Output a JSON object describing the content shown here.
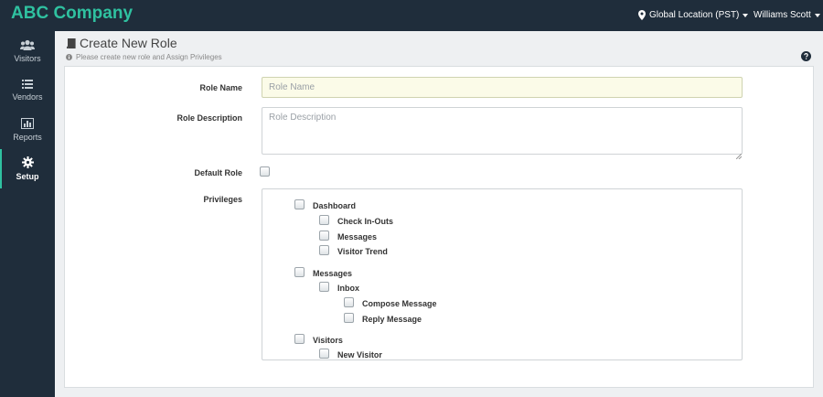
{
  "topbar": {
    "brand": "ABC Company",
    "location": "Global Location (PST)",
    "user": "Williams Scott"
  },
  "sidebar": {
    "items": [
      {
        "label": "Visitors",
        "icon": "users-icon"
      },
      {
        "label": "Vendors",
        "icon": "list-icon"
      },
      {
        "label": "Reports",
        "icon": "bar-chart-icon"
      },
      {
        "label": "Setup",
        "icon": "gear-icon",
        "active": true
      }
    ]
  },
  "page": {
    "title": "Create New Role",
    "subtitle": "Please create new role and Assign Privileges"
  },
  "form": {
    "role_name_label": "Role Name",
    "role_name_placeholder": "Role Name",
    "role_name_value": "",
    "role_desc_label": "Role Description",
    "role_desc_placeholder": "Role Description",
    "role_desc_value": "",
    "default_role_label": "Default Role",
    "default_role_checked": false,
    "privileges_label": "Privileges"
  },
  "privileges": [
    {
      "label": "Dashboard",
      "level": 0,
      "checked": false
    },
    {
      "label": "Check In-Outs",
      "level": 1,
      "checked": false
    },
    {
      "label": "Messages",
      "level": 1,
      "checked": false
    },
    {
      "label": "Visitor Trend",
      "level": 1,
      "checked": false
    },
    {
      "label": "Messages",
      "level": 0,
      "checked": false
    },
    {
      "label": "Inbox",
      "level": 1,
      "checked": false
    },
    {
      "label": "Compose Message",
      "level": 2,
      "checked": false
    },
    {
      "label": "Reply Message",
      "level": 2,
      "checked": false
    },
    {
      "label": "Visitors",
      "level": 0,
      "checked": false
    },
    {
      "label": "New Visitor",
      "level": 1,
      "checked": false
    }
  ],
  "colors": {
    "topbar": "#1f2d3b",
    "brand": "#2fc1a0",
    "input_bg": "#fbfbe8"
  }
}
